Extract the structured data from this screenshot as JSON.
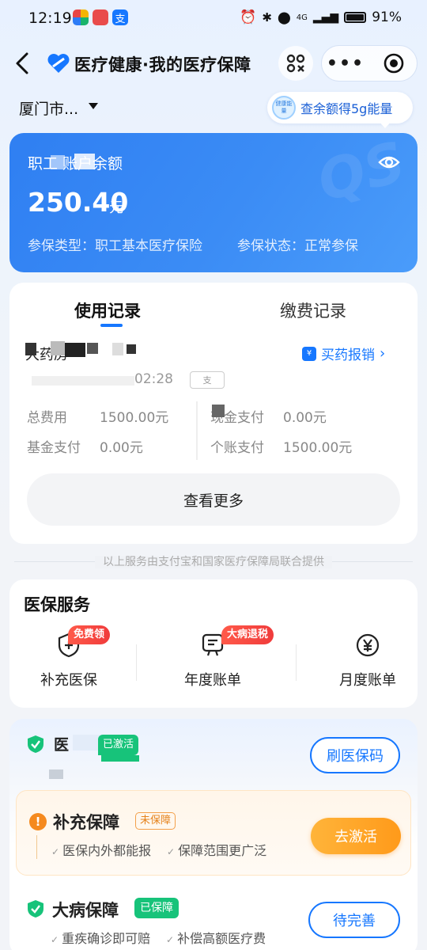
{
  "status_bar": {
    "time": "12:19",
    "network": "4G",
    "battery": "91%"
  },
  "nav": {
    "title": "医疗健康·我的医疗保障"
  },
  "location": {
    "city": "厦门市..."
  },
  "energy_tip": {
    "badge": "健康能量",
    "text": "查余额得5g能量"
  },
  "balance": {
    "label": "职工  账户余额",
    "amount": "250.40",
    "unit": "元",
    "type_text": "参保类型：职工基本医疗保险",
    "status_text": "参保状态：正常参保",
    "watermark": "QS"
  },
  "records": {
    "tabs": [
      "使用记录",
      "缴费记录"
    ],
    "merchant": "    大药房",
    "reimburse_link": "买药报销",
    "time": "02:28",
    "time_badge": "支",
    "stats": [
      {
        "label": "总费用",
        "value": "1500.00元"
      },
      {
        "label": "基金支付",
        "value": "0.00元"
      },
      {
        "label": "现金支付",
        "value": "0.00元"
      },
      {
        "label": "个账支付",
        "value": "1500.00元"
      }
    ],
    "more_button": "查看更多"
  },
  "provided_note": "以上服务由支付宝和国家医疗保障局联合提供",
  "services": {
    "title": "医保服务",
    "items": [
      {
        "label": "补充医保",
        "tag": "免费领",
        "icon": "shield-plus-icon"
      },
      {
        "label": "年度账单",
        "tag": "大病退税",
        "icon": "bill-icon"
      },
      {
        "label": "月度账单",
        "tag": "",
        "icon": "yen-icon"
      }
    ]
  },
  "insurance": {
    "name": "医",
    "activated": "已激活",
    "qr_button": "刷医保码",
    "supplementary": {
      "title": "补充保障",
      "tag": "未保障",
      "features": [
        "医保内外都能报",
        "保障范围更广泛"
      ],
      "button": "去激活"
    },
    "major_illness": {
      "title": "大病保障",
      "tag": "已保障",
      "features": [
        "重疾确诊即可赔",
        "补偿高额医疗费"
      ],
      "button": "待完善"
    }
  },
  "colors": {
    "primary": "#1677ff",
    "card_blue": "#3b8cf5",
    "tag_red": "#f03b3b",
    "green": "#17c37a",
    "orange": "#ff9a1a"
  }
}
